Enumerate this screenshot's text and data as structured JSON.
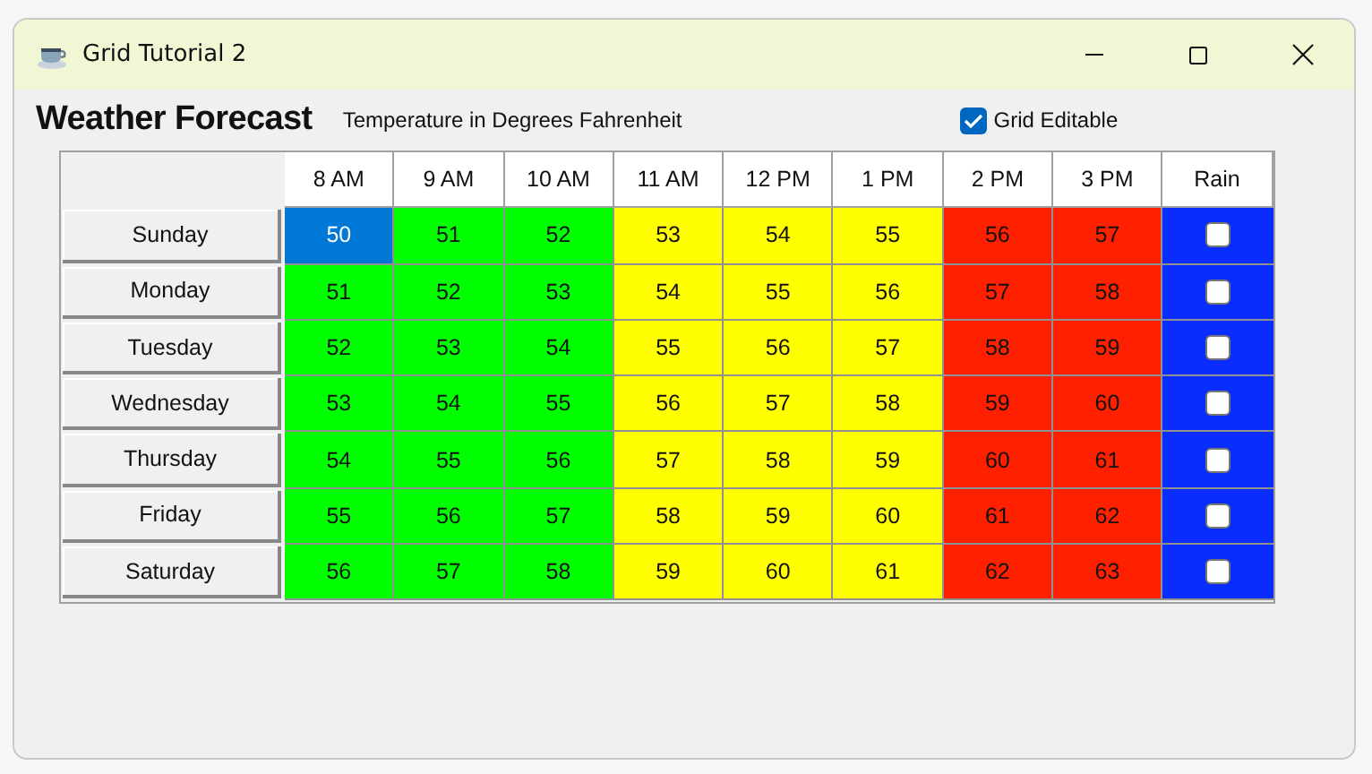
{
  "window": {
    "title": "Grid Tutorial 2"
  },
  "heading": "Weather Forecast",
  "subtitle": "Temperature in Degrees Fahrenheit",
  "grid_editable": {
    "label": "Grid Editable",
    "checked": true
  },
  "table": {
    "columns": [
      "8 AM",
      "9 AM",
      "10 AM",
      "11 AM",
      "12 PM",
      "1 PM",
      "2 PM",
      "3 PM",
      "Rain"
    ],
    "rows": [
      {
        "day": "Sunday",
        "rain_checked": false,
        "cells": [
          {
            "value": "50",
            "color": "#0078d7",
            "selected": true
          },
          {
            "value": "51",
            "color": "#00ff00",
            "selected": false
          },
          {
            "value": "52",
            "color": "#00ff00",
            "selected": false
          },
          {
            "value": "53",
            "color": "#ffff00",
            "selected": false
          },
          {
            "value": "54",
            "color": "#ffff00",
            "selected": false
          },
          {
            "value": "55",
            "color": "#ffff00",
            "selected": false
          },
          {
            "value": "56",
            "color": "#ff2000",
            "selected": false
          },
          {
            "value": "57",
            "color": "#ff2000",
            "selected": false
          }
        ]
      },
      {
        "day": "Monday",
        "rain_checked": false,
        "cells": [
          {
            "value": "51",
            "color": "#00ff00",
            "selected": false
          },
          {
            "value": "52",
            "color": "#00ff00",
            "selected": false
          },
          {
            "value": "53",
            "color": "#00ff00",
            "selected": false
          },
          {
            "value": "54",
            "color": "#ffff00",
            "selected": false
          },
          {
            "value": "55",
            "color": "#ffff00",
            "selected": false
          },
          {
            "value": "56",
            "color": "#ffff00",
            "selected": false
          },
          {
            "value": "57",
            "color": "#ff2000",
            "selected": false
          },
          {
            "value": "58",
            "color": "#ff2000",
            "selected": false
          }
        ]
      },
      {
        "day": "Tuesday",
        "rain_checked": false,
        "cells": [
          {
            "value": "52",
            "color": "#00ff00",
            "selected": false
          },
          {
            "value": "53",
            "color": "#00ff00",
            "selected": false
          },
          {
            "value": "54",
            "color": "#00ff00",
            "selected": false
          },
          {
            "value": "55",
            "color": "#ffff00",
            "selected": false
          },
          {
            "value": "56",
            "color": "#ffff00",
            "selected": false
          },
          {
            "value": "57",
            "color": "#ffff00",
            "selected": false
          },
          {
            "value": "58",
            "color": "#ff2000",
            "selected": false
          },
          {
            "value": "59",
            "color": "#ff2000",
            "selected": false
          }
        ]
      },
      {
        "day": "Wednesday",
        "rain_checked": false,
        "cells": [
          {
            "value": "53",
            "color": "#00ff00",
            "selected": false
          },
          {
            "value": "54",
            "color": "#00ff00",
            "selected": false
          },
          {
            "value": "55",
            "color": "#00ff00",
            "selected": false
          },
          {
            "value": "56",
            "color": "#ffff00",
            "selected": false
          },
          {
            "value": "57",
            "color": "#ffff00",
            "selected": false
          },
          {
            "value": "58",
            "color": "#ffff00",
            "selected": false
          },
          {
            "value": "59",
            "color": "#ff2000",
            "selected": false
          },
          {
            "value": "60",
            "color": "#ff2000",
            "selected": false
          }
        ]
      },
      {
        "day": "Thursday",
        "rain_checked": false,
        "cells": [
          {
            "value": "54",
            "color": "#00ff00",
            "selected": false
          },
          {
            "value": "55",
            "color": "#00ff00",
            "selected": false
          },
          {
            "value": "56",
            "color": "#00ff00",
            "selected": false
          },
          {
            "value": "57",
            "color": "#ffff00",
            "selected": false
          },
          {
            "value": "58",
            "color": "#ffff00",
            "selected": false
          },
          {
            "value": "59",
            "color": "#ffff00",
            "selected": false
          },
          {
            "value": "60",
            "color": "#ff2000",
            "selected": false
          },
          {
            "value": "61",
            "color": "#ff2000",
            "selected": false
          }
        ]
      },
      {
        "day": "Friday",
        "rain_checked": false,
        "cells": [
          {
            "value": "55",
            "color": "#00ff00",
            "selected": false
          },
          {
            "value": "56",
            "color": "#00ff00",
            "selected": false
          },
          {
            "value": "57",
            "color": "#00ff00",
            "selected": false
          },
          {
            "value": "58",
            "color": "#ffff00",
            "selected": false
          },
          {
            "value": "59",
            "color": "#ffff00",
            "selected": false
          },
          {
            "value": "60",
            "color": "#ffff00",
            "selected": false
          },
          {
            "value": "61",
            "color": "#ff2000",
            "selected": false
          },
          {
            "value": "62",
            "color": "#ff2000",
            "selected": false
          }
        ]
      },
      {
        "day": "Saturday",
        "rain_checked": false,
        "cells": [
          {
            "value": "56",
            "color": "#00ff00",
            "selected": false
          },
          {
            "value": "57",
            "color": "#00ff00",
            "selected": false
          },
          {
            "value": "58",
            "color": "#00ff00",
            "selected": false
          },
          {
            "value": "59",
            "color": "#ffff00",
            "selected": false
          },
          {
            "value": "60",
            "color": "#ffff00",
            "selected": false
          },
          {
            "value": "61",
            "color": "#ffff00",
            "selected": false
          },
          {
            "value": "62",
            "color": "#ff2000",
            "selected": false
          },
          {
            "value": "63",
            "color": "#ff2000",
            "selected": false
          }
        ]
      }
    ]
  }
}
